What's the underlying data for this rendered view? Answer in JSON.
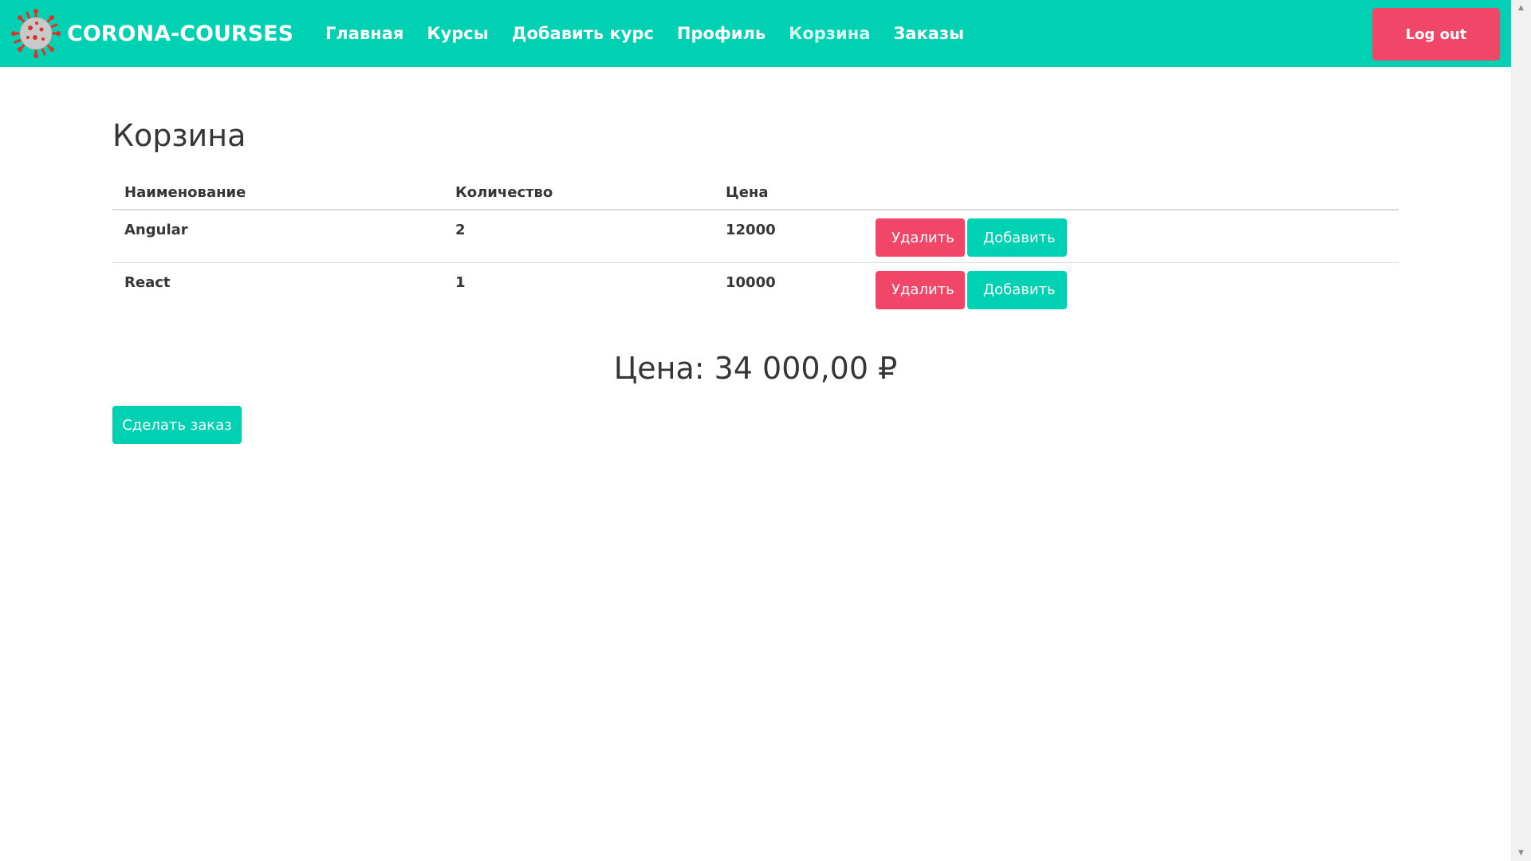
{
  "navbar": {
    "brand": "CORONA-COURSES",
    "logo_icon": "virus-icon",
    "links": [
      {
        "label": "Главная",
        "active": false
      },
      {
        "label": "Курсы",
        "active": false
      },
      {
        "label": "Добавить курс",
        "active": false
      },
      {
        "label": "Профиль",
        "active": false
      },
      {
        "label": "Корзина",
        "active": true
      },
      {
        "label": "Заказы",
        "active": false
      }
    ],
    "logout_label": "Log out"
  },
  "cart": {
    "title": "Корзина",
    "columns": [
      "Наименование",
      "Количество",
      "Цена"
    ],
    "items": [
      {
        "name": "Angular",
        "quantity": "2",
        "price": "12000",
        "delete_label": "Удалить",
        "add_label": "Добавить"
      },
      {
        "name": "React",
        "quantity": "1",
        "price": "10000",
        "delete_label": "Удалить",
        "add_label": "Добавить"
      }
    ],
    "total": "Цена: 34 000,00 ₽",
    "order_label": "Сделать заказ"
  },
  "colors": {
    "primary": "#00d1b2",
    "danger": "#f14668",
    "text": "#363636"
  }
}
